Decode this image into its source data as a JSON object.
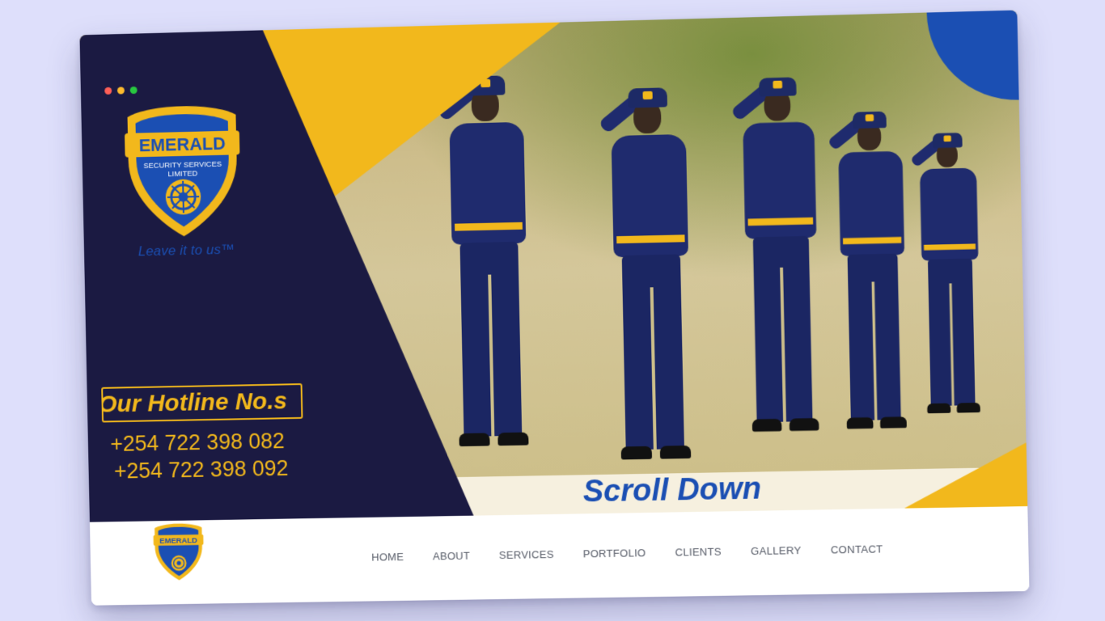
{
  "brand": {
    "name": "EMERALD",
    "subtitle_line1": "SECURITY SERVICES",
    "subtitle_line2": "LIMITED",
    "tagline": "Leave it to us™"
  },
  "hotline": {
    "label": "Our Hotline No.s",
    "numbers": [
      "+254 722 398 082",
      "+254 722 398 092"
    ]
  },
  "hero": {
    "scroll_label": "Scroll Down"
  },
  "window_controls": {
    "colors": [
      "#ff5f57",
      "#febc2e",
      "#28c840"
    ]
  },
  "nav": {
    "items": [
      {
        "label": "HOME"
      },
      {
        "label": "ABOUT"
      },
      {
        "label": "SERVICES"
      },
      {
        "label": "PORTFOLIO"
      },
      {
        "label": "CLIENTS"
      },
      {
        "label": "GALLERY"
      },
      {
        "label": "CONTACT"
      }
    ]
  },
  "colors": {
    "navy": "#1b1a42",
    "yellow": "#f2b81c",
    "blue": "#1b4fb3",
    "page_bg": "#dedffb"
  }
}
